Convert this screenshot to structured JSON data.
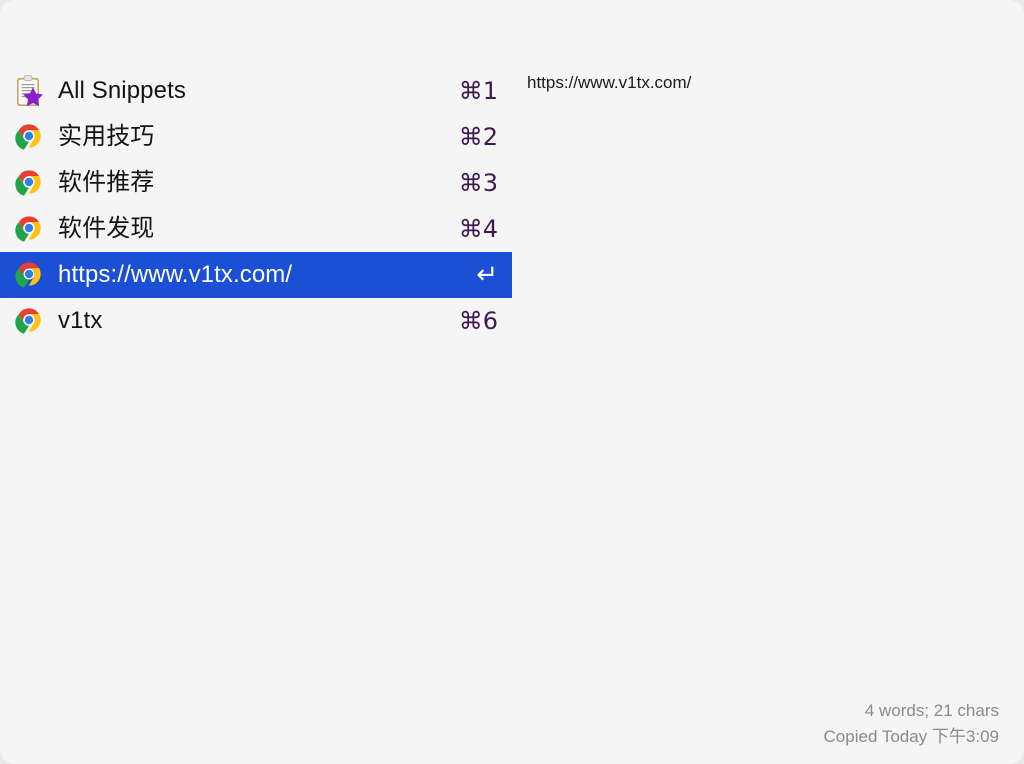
{
  "app": {
    "name": "PopClip Snippets Menu",
    "theme": {
      "background": "#f5f5f6",
      "outer_background": "#e9e9ea",
      "selection": "#1a4fd6",
      "selection_text": "#ffffff",
      "label_text": "#141414",
      "shortcut_text": "#3f1a52",
      "footer_text": "#8a8a8e"
    }
  },
  "list": {
    "rows": [
      {
        "label": "All Snippets",
        "shortcut": "⌘1",
        "icon": "clipboard-star-icon",
        "selected": false
      },
      {
        "label": "实用技巧",
        "shortcut": "⌘2",
        "icon": "chrome-icon",
        "selected": false
      },
      {
        "label": "软件推荐",
        "shortcut": "⌘3",
        "icon": "chrome-icon",
        "selected": false
      },
      {
        "label": "软件发现",
        "shortcut": "⌘4",
        "icon": "chrome-icon",
        "selected": false
      },
      {
        "label": "https://www.v1tx.com/",
        "shortcut": "↵",
        "icon": "chrome-icon",
        "selected": true
      },
      {
        "label": "v1tx",
        "shortcut": "⌘6",
        "icon": "chrome-icon",
        "selected": false
      }
    ]
  },
  "preview": {
    "text": "https://www.v1tx.com/"
  },
  "footer": {
    "stats": "4 words; 21 chars",
    "copied": "Copied Today 下午3:09"
  }
}
